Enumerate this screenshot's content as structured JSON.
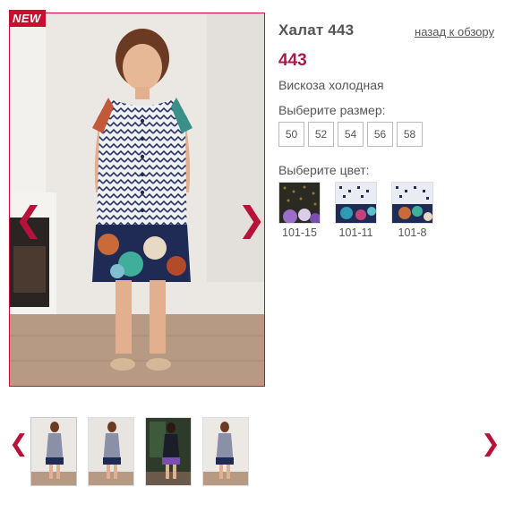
{
  "product": {
    "badge": "NEW",
    "title": "Халат 443",
    "back_link": "назад к обзору",
    "price": "443",
    "material": "Вискоза холодная",
    "size_label": "Выберите размер:",
    "sizes": [
      "50",
      "52",
      "54",
      "56",
      "58"
    ],
    "color_label": "Выберите цвет:",
    "colors": [
      {
        "label": "101-15"
      },
      {
        "label": "101-11"
      },
      {
        "label": "101-8"
      }
    ]
  },
  "gallery": {
    "prev_glyph": "❮",
    "next_glyph": "❯",
    "thumbnail_count": 4
  },
  "theme": {
    "accent": "#c8102e",
    "price_color": "#a61c4b",
    "arrow_color": "#b8123a"
  }
}
